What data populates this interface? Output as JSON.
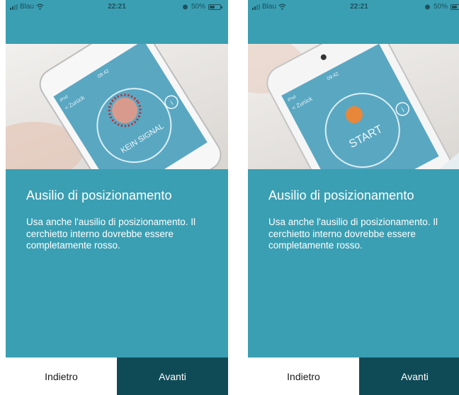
{
  "screens": [
    {
      "status": {
        "carrier": "Blau",
        "time": "22:21",
        "battery": "50%",
        "battery_level": 0.5
      },
      "hero": {
        "phone_time": "09:42",
        "phone_carrier": "iPod",
        "back_label": "< Zurück",
        "overlay_label": "KEIN SIGNAL",
        "info_glyph": "i"
      },
      "title": "Ausilio di posizionamento",
      "body": "Usa anche l'ausilio di posizionamento. Il cerchietto interno dovrebbe essere completamente rosso.",
      "back_button": "Indietro",
      "next_button": "Avanti"
    },
    {
      "status": {
        "carrier": "Blau",
        "time": "22:21",
        "battery": "50%",
        "battery_level": 0.5
      },
      "hero": {
        "phone_time": "09:42",
        "phone_carrier": "iPod",
        "back_label": "< Zurück",
        "overlay_label": "START",
        "info_glyph": "i"
      },
      "title": "Ausilio di posizionamento",
      "body": "Usa anche l'ausilio di posizionamento. Il cerchietto interno dovrebbe essere completamente rosso.",
      "back_button": "Indietro",
      "next_button": "Avanti"
    }
  ],
  "colors": {
    "background": "#3a9fb3",
    "next_button_bg": "#0f4b57",
    "back_button_bg": "#ffffff",
    "indicator_red": "#c0262b",
    "start_dot": "#e8873a"
  },
  "icons": [
    "signal-icon",
    "wifi-icon",
    "alarm-icon",
    "battery-icon",
    "back-chevron-icon",
    "info-icon"
  ]
}
